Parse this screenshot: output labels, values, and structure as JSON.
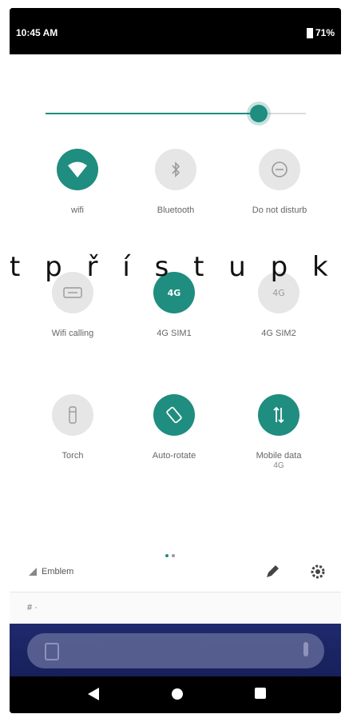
{
  "status_bar": {
    "time": "10:45 AM",
    "battery": "71%"
  },
  "brightness": {
    "level": 0.82
  },
  "overlay_text": "t  p ř í s t u p   k",
  "tiles": [
    {
      "id": "wifi",
      "label": "wifi",
      "sublabel": "",
      "active": true,
      "icon": "wifi-icon"
    },
    {
      "id": "bluetooth",
      "label": "Bluetooth",
      "sublabel": "",
      "active": false,
      "icon": "bluetooth-icon"
    },
    {
      "id": "dnd",
      "label": "Do not disturb",
      "sublabel": "",
      "active": false,
      "icon": "do-not-disturb-icon"
    },
    {
      "id": "wifi-calling",
      "label": "Wifi calling",
      "sublabel": "",
      "active": false,
      "icon": "wifi-calling-icon"
    },
    {
      "id": "4g-sim1",
      "label": "4G SIM1",
      "sublabel": "",
      "active": true,
      "icon": "4g-icon"
    },
    {
      "id": "4g-sim2",
      "label": "4G SIM2",
      "sublabel": "",
      "active": false,
      "icon": "4g-icon"
    },
    {
      "id": "torch",
      "label": "Torch",
      "sublabel": "",
      "active": false,
      "icon": "flashlight-icon"
    },
    {
      "id": "auto-rotate",
      "label": "Auto-rotate",
      "sublabel": "",
      "active": true,
      "icon": "auto-rotate-icon"
    },
    {
      "id": "mobile-data",
      "label": "Mobile data",
      "sublabel": "4G",
      "active": true,
      "icon": "mobile-data-icon"
    }
  ],
  "footer": {
    "carrier": "Emblem"
  },
  "notification_bar": {
    "text": "#  ·"
  },
  "colors": {
    "accent": "#1f8d7f",
    "tile_off": "#e6e6e6"
  }
}
